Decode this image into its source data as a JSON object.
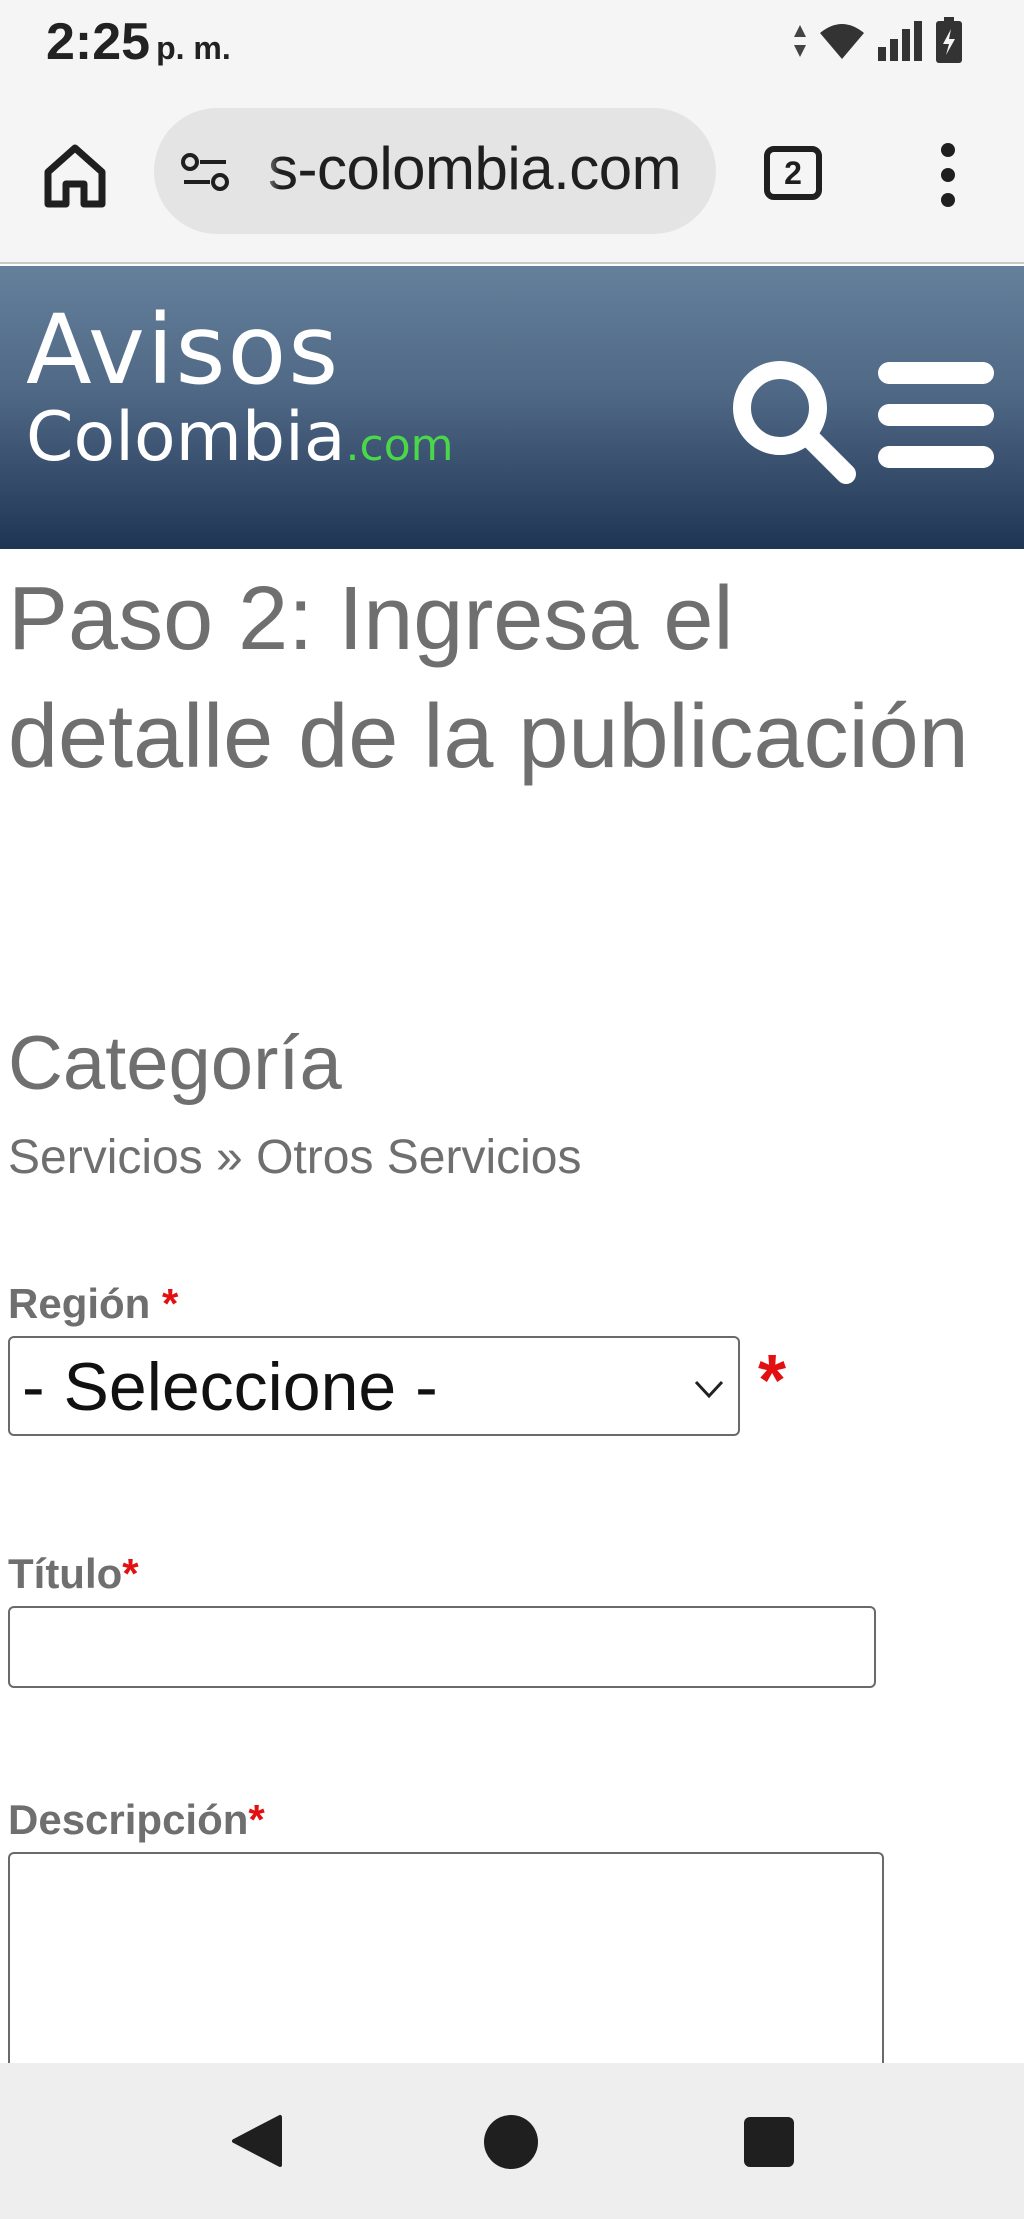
{
  "status_bar": {
    "time": "2:25",
    "ampm": "p. m."
  },
  "browser": {
    "url": "s-colombia.com",
    "tab_count": "2"
  },
  "site": {
    "logo_line1": "Avisos",
    "logo_line2": "Colombia",
    "logo_suffix": ".com"
  },
  "page": {
    "title": "Paso 2: Ingresa el detalle de la publicación",
    "category_heading": "Categoría",
    "category_path": "Servicios » Otros Servicios"
  },
  "form": {
    "region_label": "Región",
    "region_required": "*",
    "region_value": "- Seleccione -",
    "region_select_required": "*",
    "title_label": "Título",
    "title_required": "*",
    "title_value": "",
    "description_label": "Descripción",
    "description_required": "*",
    "description_value": ""
  },
  "colors": {
    "header_top": "#64809b",
    "header_bottom": "#1f3554",
    "logo_accent": "#4ad84a",
    "required": "#e21010",
    "text_gray": "#6f6f6f"
  }
}
